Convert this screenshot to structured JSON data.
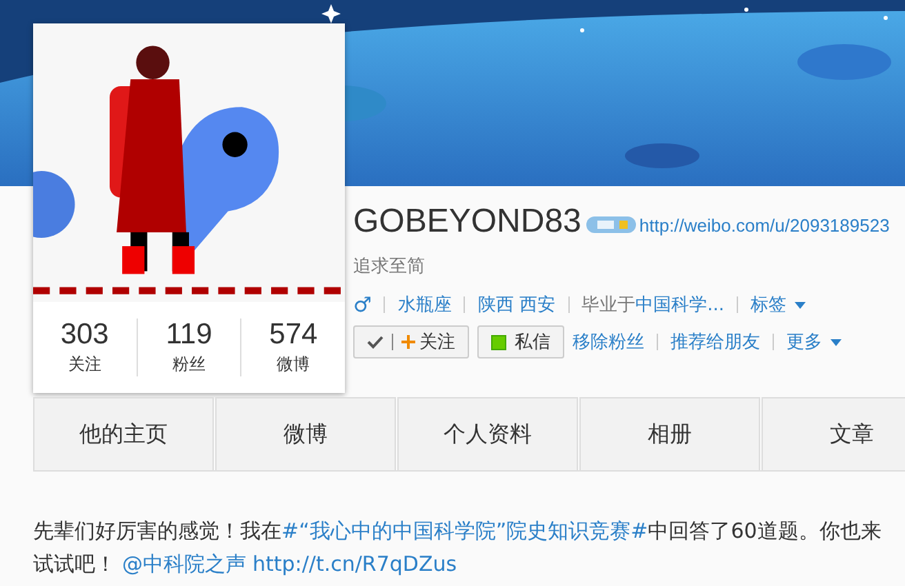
{
  "profile": {
    "name": "GOBEYOND83",
    "url": "http://weibo.com/u/2093189523",
    "motto": "追求至简",
    "gender": "♂",
    "info": [
      {
        "kind": "link",
        "text": "水瓶座"
      },
      {
        "kind": "link",
        "text": "陕西 西安"
      },
      {
        "kind": "school",
        "label": "毕业于",
        "text": "中国科学..."
      },
      {
        "kind": "dropdown",
        "text": "标签"
      }
    ],
    "stats": [
      {
        "value": "303",
        "label": "关注"
      },
      {
        "value": "119",
        "label": "粉丝"
      },
      {
        "value": "574",
        "label": "微博"
      }
    ],
    "actions": [
      {
        "kind": "follow",
        "text": "关注",
        "checked": true
      },
      {
        "kind": "message",
        "text": "私信"
      },
      {
        "kind": "link",
        "text": "移除粉丝"
      },
      {
        "kind": "link",
        "text": "推荐给朋友"
      },
      {
        "kind": "dropdown",
        "text": "更多"
      }
    ]
  },
  "tabs": [
    {
      "label": "他的主页",
      "selected": false
    },
    {
      "label": "微博",
      "selected": false
    },
    {
      "label": "个人资料",
      "selected": false
    },
    {
      "label": "相册",
      "selected": false
    },
    {
      "label": "文章",
      "selected": false
    }
  ],
  "post": {
    "segments": [
      {
        "kind": "text",
        "text": "先辈们好厉害的感觉！我在"
      },
      {
        "kind": "link",
        "text": "#“我心中的中国科学院”院史知识竞赛#"
      },
      {
        "kind": "text",
        "text": "中回答了60道题。你也来试试吧！"
      },
      {
        "kind": "link",
        "text": "@中科院之声"
      },
      {
        "kind": "link",
        "text": "http://t.cn/R7qDZus"
      }
    ]
  }
}
